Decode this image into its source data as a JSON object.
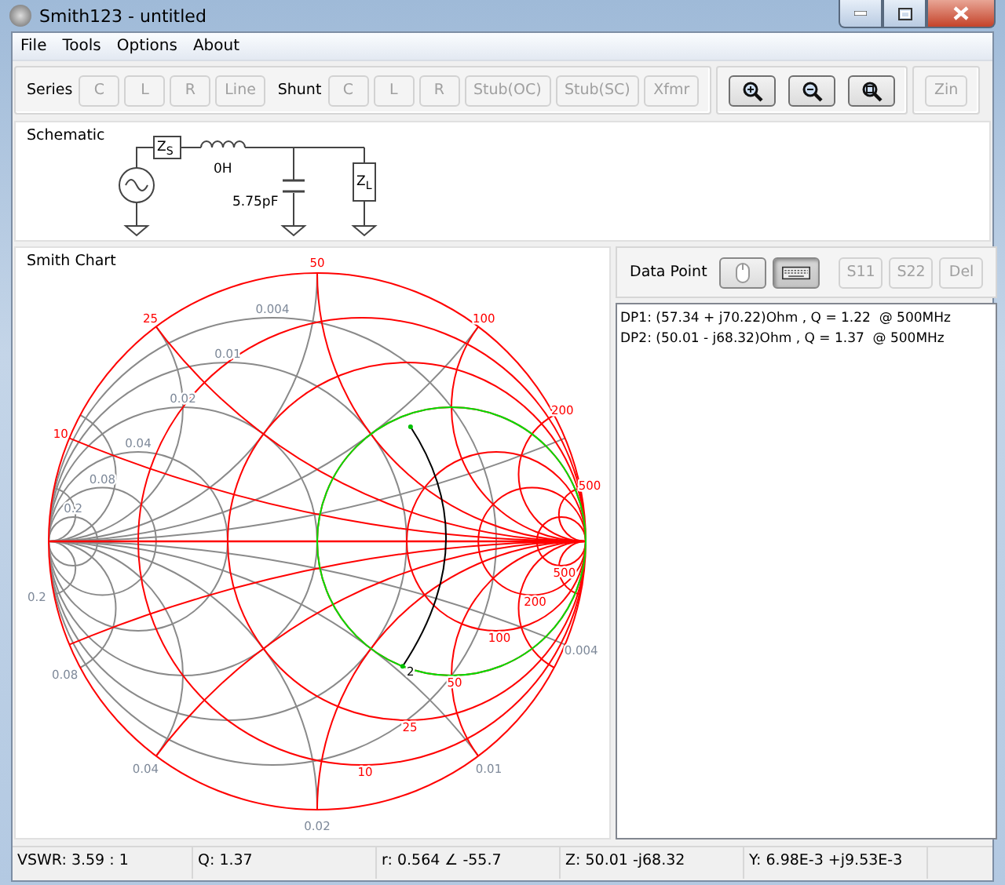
{
  "window": {
    "title": "Smith123 - untitled"
  },
  "menu": [
    "File",
    "Tools",
    "Options",
    "About"
  ],
  "toolbar": {
    "series_label": "Series",
    "series_buttons": [
      {
        "label": "C",
        "disabled": true
      },
      {
        "label": "L",
        "disabled": true
      },
      {
        "label": "R",
        "disabled": true
      },
      {
        "label": "Line",
        "disabled": true
      }
    ],
    "shunt_label": "Shunt",
    "shunt_buttons": [
      {
        "label": "C",
        "disabled": true
      },
      {
        "label": "L",
        "disabled": true
      },
      {
        "label": "R",
        "disabled": true
      },
      {
        "label": "Stub(OC)",
        "disabled": true
      },
      {
        "label": "Stub(SC)",
        "disabled": true
      },
      {
        "label": "Xfmr",
        "disabled": true
      }
    ],
    "zoom_buttons": [
      {
        "kind": "zoom-in",
        "disabled": false
      },
      {
        "kind": "zoom-out",
        "disabled": false
      },
      {
        "kind": "zoom-fit",
        "disabled": false
      }
    ],
    "zin_button": {
      "label": "Zin",
      "disabled": true
    }
  },
  "schematic": {
    "title": "Schematic",
    "source_label": "Z$_{S}$",
    "inductor_value": "0H",
    "capacitor_value": "5.75pF",
    "load_label": "Z$_{L}$"
  },
  "smith_chart": {
    "title": "Smith Chart",
    "reactance_labels": [
      "10",
      "25",
      "50",
      "100",
      "200",
      "500"
    ],
    "resistance_labels": [
      "10",
      "25",
      "50",
      "100",
      "200",
      "500"
    ],
    "conductance_labels": [
      "0.004",
      "0.01",
      "0.02",
      "0.04",
      "0.08",
      "0.2"
    ],
    "susceptance_labels": [
      "0.004",
      "0.01",
      "0.02",
      "0.04",
      "0.08",
      "0.2"
    ],
    "point_label": "2"
  },
  "data_point_panel": {
    "title": "Data Point",
    "mode_buttons": [
      {
        "kind": "mouse",
        "selected": false
      },
      {
        "kind": "keyboard",
        "selected": true
      }
    ],
    "buttons": [
      {
        "label": "S11",
        "disabled": true
      },
      {
        "label": "S22",
        "disabled": true
      },
      {
        "label": "Del",
        "disabled": true
      }
    ],
    "points": [
      "DP1: (57.34 + j70.22)Ohm , Q = 1.22  @ 500MHz",
      "DP2: (50.01 - j68.32)Ohm , Q = 1.37  @ 500MHz"
    ]
  },
  "status_bar": [
    "VSWR: 3.59 : 1",
    "Q: 1.37",
    "r: 0.564 ∠ -55.7",
    "Z: 50.01 -j68.32",
    "Y: 6.98E-3 +j9.53E-3"
  ]
}
